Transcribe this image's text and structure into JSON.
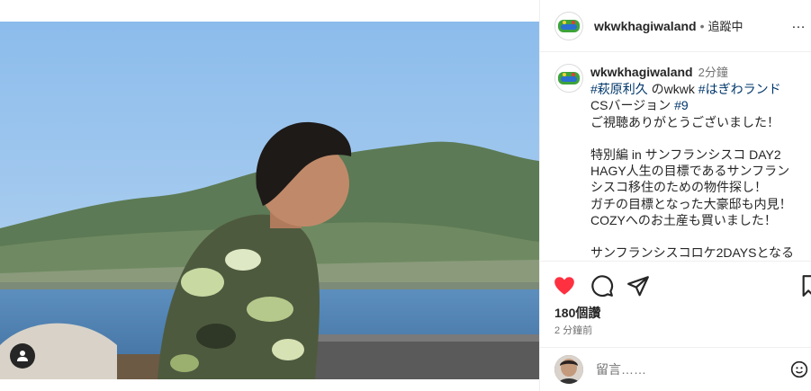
{
  "post": {
    "username": "wkwkhagiwaland",
    "separator": "•",
    "follow_status": "追蹤中",
    "more_label": "…"
  },
  "caption": {
    "username": "wkwkhagiwaland",
    "time": "2分鐘",
    "tag1": "#萩原利久",
    "text1": " のwkwk ",
    "tag2": "#はぎわランド",
    "text2": "CSバージョン ",
    "tag3": "#9",
    "lines": [
      "ご視聴ありがとうございました！",
      "",
      "特別編 in サンフランシスコ DAY2",
      "HAGY人生の目標であるサンフラン",
      "シスコ移住のための物件探し！",
      "ガチの目標となった大豪邸も内見！",
      "COZYへのお土産も買いました！",
      "",
      "サンフランシスコロケ2DAYSとなる"
    ]
  },
  "engagement": {
    "likes": "180個讚",
    "posted_ago": "2 分鐘前"
  },
  "comment": {
    "placeholder": "留言……"
  },
  "icons": {
    "tag_user": "user-icon",
    "like": "heart-icon",
    "comment": "comment-icon",
    "share": "send-icon",
    "save": "bookmark-icon",
    "emoji": "emoji-icon"
  },
  "colors": {
    "like_red": "#ff3040",
    "hashtag_blue": "#00376b",
    "muted_gray": "#737373"
  }
}
